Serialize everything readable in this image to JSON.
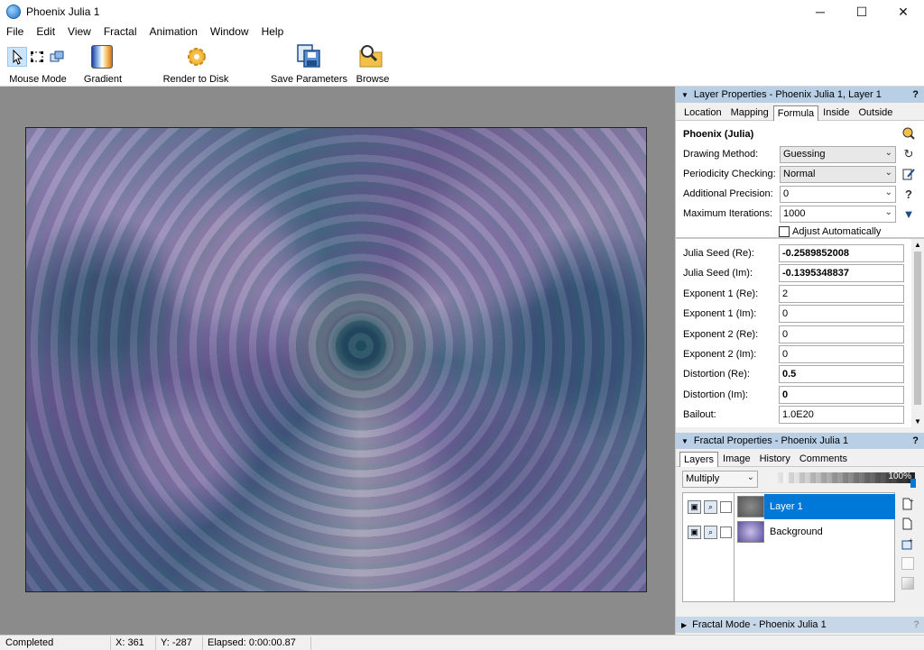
{
  "window": {
    "title": "Phoenix Julia 1"
  },
  "window_controls": {
    "minimize": "─",
    "maximize": "☐",
    "close": "✕"
  },
  "menu": [
    "File",
    "Edit",
    "View",
    "Fractal",
    "Animation",
    "Window",
    "Help"
  ],
  "toolbar": {
    "mouse_mode": "Mouse Mode",
    "gradient": "Gradient",
    "render": "Render to Disk",
    "save_params": "Save Parameters",
    "browse": "Browse"
  },
  "layer_panel": {
    "header": "Layer Properties - Phoenix Julia 1, Layer 1",
    "help": "?",
    "tabs": [
      "Location",
      "Mapping",
      "Formula",
      "Inside",
      "Outside"
    ],
    "active_tab": "Formula",
    "formula_name": "Phoenix (Julia)",
    "drawing_method_label": "Drawing Method:",
    "drawing_method": "Guessing",
    "periodicity_label": "Periodicity Checking:",
    "periodicity": "Normal",
    "precision_label": "Additional Precision:",
    "precision": "0",
    "max_iter_label": "Maximum Iterations:",
    "max_iter": "1000",
    "adjust_label": "Adjust Automatically",
    "params": [
      {
        "label": "Julia Seed (Re):",
        "value": "-0.2589852008",
        "bold": true
      },
      {
        "label": "Julia Seed (Im):",
        "value": "-0.1395348837",
        "bold": true
      },
      {
        "label": "Exponent 1 (Re):",
        "value": "2",
        "bold": false
      },
      {
        "label": "Exponent 1 (Im):",
        "value": "0",
        "bold": false
      },
      {
        "label": "Exponent 2 (Re):",
        "value": "0",
        "bold": false
      },
      {
        "label": "Exponent 2 (Im):",
        "value": "0",
        "bold": false
      },
      {
        "label": "Distortion (Re):",
        "value": "0.5",
        "bold": true
      },
      {
        "label": "Distortion (Im):",
        "value": "0",
        "bold": true
      },
      {
        "label": "Bailout:",
        "value": "1.0E20",
        "bold": false
      }
    ]
  },
  "fractal_panel": {
    "header": "Fractal Properties - Phoenix Julia 1",
    "help": "?",
    "tabs": [
      "Layers",
      "Image",
      "History",
      "Comments"
    ],
    "active_tab": "Layers",
    "blend_mode": "Multiply",
    "opacity": "100%",
    "layers": [
      {
        "name": "Layer 1",
        "selected": true
      },
      {
        "name": "Background",
        "selected": false
      }
    ]
  },
  "mode_panel": {
    "header": "Fractal Mode - Phoenix Julia 1",
    "help": "?"
  },
  "status": {
    "state": "Completed",
    "x": "X: 361",
    "y": "Y: -287",
    "elapsed": "Elapsed: 0:00:00.87"
  }
}
